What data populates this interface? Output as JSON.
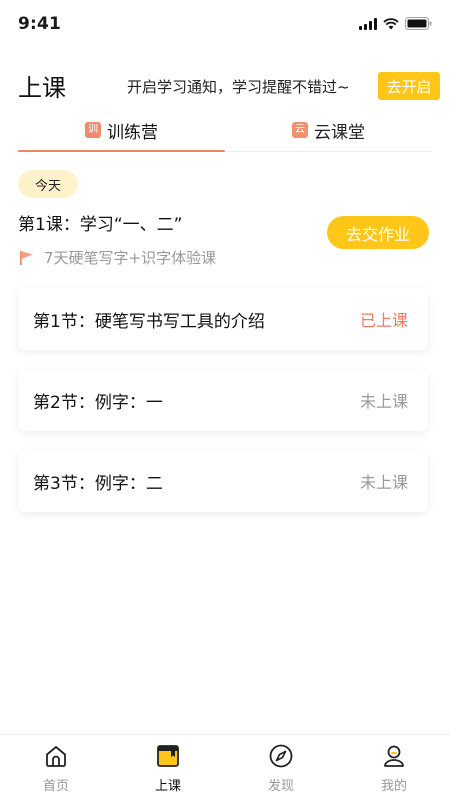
{
  "status_bar": {
    "time": "9:41",
    "icons": [
      "signal-icon",
      "wifi-icon",
      "battery-icon"
    ]
  },
  "header": {
    "title": "上课",
    "notice": "开启学习通知，学习提醒不错过~",
    "enable_label": "去开启"
  },
  "tabs": [
    {
      "badge": "训",
      "label": "训练营",
      "active": true
    },
    {
      "badge": "云",
      "label": "云课堂",
      "active": false
    }
  ],
  "today_chip": "今天",
  "lesson": {
    "title": "第1课：学习“一、二”",
    "course": "7天硬笔写字+识字体验课",
    "course_icon": "flag-icon",
    "submit_label": "去交作业"
  },
  "sections": [
    {
      "name": "第1节：硬笔写书写工具的介绍",
      "status": "已上课"
    },
    {
      "name": "第2节：例字：一",
      "status": "未上课"
    },
    {
      "name": "第3节：例字：二",
      "status": "未上课"
    }
  ],
  "bottom_nav": [
    {
      "label": "首页",
      "icon": "home-icon",
      "active": false
    },
    {
      "label": "上课",
      "icon": "course-book-icon",
      "active": true
    },
    {
      "label": "发现",
      "icon": "compass-icon",
      "active": false
    },
    {
      "label": "我的",
      "icon": "profile-icon",
      "active": false
    }
  ],
  "colors": {
    "accent_yellow": "#ffc61a",
    "accent_coral": "#f08366",
    "muted_gray": "#999999"
  }
}
